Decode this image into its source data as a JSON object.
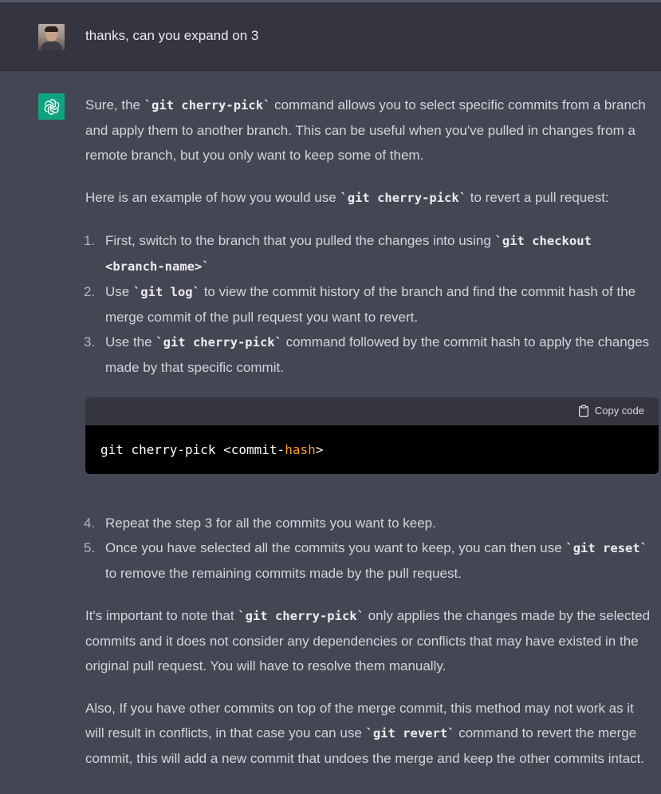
{
  "user_message": {
    "text": "thanks, can you expand on 3"
  },
  "assistant_message": {
    "intro_before_code": "Sure, the ",
    "intro_code": "`git cherry-pick`",
    "intro_after_code": " command allows you to select specific commits from a branch and apply them to another branch. This can be useful when you've pulled in changes from a remote branch, but you only want to keep some of them.",
    "example_before": "Here is an example of how you would use ",
    "example_code": "`git cherry-pick`",
    "example_after": " to revert a pull request:",
    "steps": [
      {
        "num": "1.",
        "before": "First, switch to the branch that you pulled the changes into using ",
        "code": "`git checkout <branch-name>`",
        "after": ""
      },
      {
        "num": "2.",
        "before": "Use ",
        "code": "`git log`",
        "after": " to view the commit history of the branch and find the commit hash of the merge commit of the pull request you want to revert."
      },
      {
        "num": "3.",
        "before": "Use the ",
        "code": "`git cherry-pick`",
        "after": " command followed by the commit hash to apply the changes made by that specific commit."
      },
      {
        "num": "4.",
        "before": "Repeat the step 3 for all the commits you want to keep.",
        "code": "",
        "after": ""
      },
      {
        "num": "5.",
        "before": "Once you have selected all the commits you want to keep, you can then use ",
        "code": "`git reset`",
        "after": " to remove the remaining commits made by the pull request."
      }
    ],
    "code_block": {
      "copy_label": "Copy code",
      "code_main": "git cherry-pick <commit-",
      "code_highlight": "hash",
      "code_end": ">"
    },
    "note_before": "It's important to note that ",
    "note_code": "`git cherry-pick`",
    "note_after": " only applies the changes made by the selected commits and it does not consider any dependencies or conflicts that may have existed in the original pull request. You will have to resolve them manually.",
    "last_before": "Also, If you have other commits on top of the merge commit, this method may not work as it will result in conflicts, in that case you can use ",
    "last_code": "`git revert`",
    "last_after": " command to revert the merge commit, this will add a new commit that undoes the merge and keep the other commits intact."
  },
  "colors": {
    "user_bg": "#343541",
    "assistant_bg": "#444654",
    "gpt_green": "#10a37f",
    "code_hash": "#f99d39"
  },
  "icons": {
    "user_avatar": "user-photo-avatar",
    "assistant_avatar": "openai-logo-icon",
    "copy": "clipboard-icon"
  }
}
